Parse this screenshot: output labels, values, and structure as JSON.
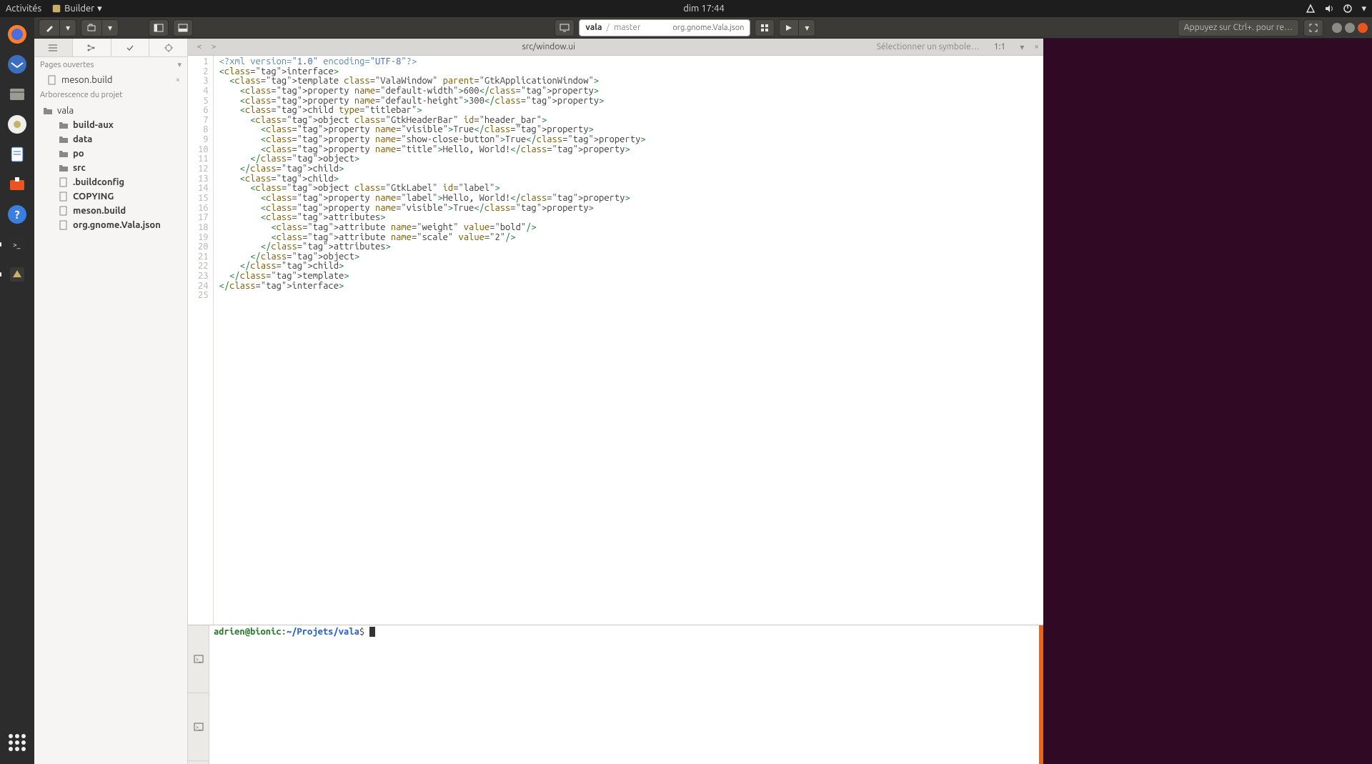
{
  "topbar": {
    "activities": "Activités",
    "app_menu": "Builder",
    "clock": "dim 17:44"
  },
  "headerbar": {
    "omni_project": "vala",
    "omni_branch": "master",
    "omni_runtarget": "org.gnome.Vala.json",
    "search_placeholder": "Appuyez sur Ctrl+. pour re…"
  },
  "sidebar": {
    "open_pages_label": "Pages ouvertes",
    "open_file": "meson.build",
    "tree_label": "Arborescence du projet",
    "root": "vala",
    "items": [
      {
        "type": "folder",
        "name": "build-aux",
        "bold": true
      },
      {
        "type": "folder",
        "name": "data",
        "bold": true
      },
      {
        "type": "folder",
        "name": "po",
        "bold": true
      },
      {
        "type": "folder",
        "name": "src",
        "bold": true
      },
      {
        "type": "file",
        "name": ".buildconfig",
        "bold": true
      },
      {
        "type": "file",
        "name": "COPYING",
        "bold": true
      },
      {
        "type": "file",
        "name": "meson.build",
        "bold": true
      },
      {
        "type": "file",
        "name": "org.gnome.Vala.json",
        "bold": true
      }
    ]
  },
  "tabbar": {
    "title": "src/window.ui",
    "symbol_placeholder": "Sélectionner un symbole…",
    "position": "1:1"
  },
  "code_lines": [
    "<?xml version=\"1.0\" encoding=\"UTF-8\"?>",
    "<interface>",
    "  <template class=\"ValaWindow\" parent=\"GtkApplicationWindow\">",
    "    <property name=\"default-width\">600</property>",
    "    <property name=\"default-height\">300</property>",
    "    <child type=\"titlebar\">",
    "      <object class=\"GtkHeaderBar\" id=\"header_bar\">",
    "        <property name=\"visible\">True</property>",
    "        <property name=\"show-close-button\">True</property>",
    "        <property name=\"title\">Hello, World!</property>",
    "      </object>",
    "    </child>",
    "    <child>",
    "      <object class=\"GtkLabel\" id=\"label\">",
    "        <property name=\"label\">Hello, World!</property>",
    "        <property name=\"visible\">True</property>",
    "        <attributes>",
    "          <attribute name=\"weight\" value=\"bold\"/>",
    "          <attribute name=\"scale\" value=\"2\"/>",
    "        </attributes>",
    "      </object>",
    "    </child>",
    "  </template>",
    "</interface>",
    ""
  ],
  "terminal": {
    "user": "adrien",
    "host": "bionic",
    "path": "~/Projets/vala",
    "prompt_suffix": "$"
  }
}
